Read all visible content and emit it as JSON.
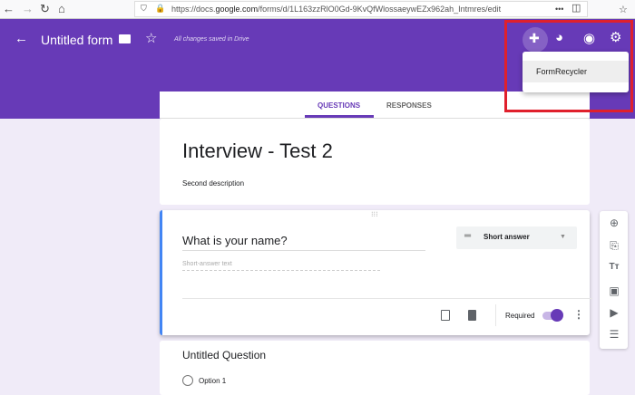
{
  "browser": {
    "url_prefix": "https://docs.",
    "url_domain": "google.com",
    "url_path": "/forms/d/1L163zzRlO0Gd-9KvQfWlossaeywEZx962ah_Intmres/edit",
    "more": "•••"
  },
  "header": {
    "title": "Untitled form",
    "saved_status": "All changes saved in Drive"
  },
  "tabs": [
    "QUESTIONS",
    "RESPONSES"
  ],
  "form": {
    "title": "Interview - Test 2",
    "description": "Second description"
  },
  "question": {
    "title": "What is your name?",
    "type": "Short answer",
    "placeholder": "Short-answer text",
    "required_label": "Required",
    "required": true
  },
  "next_question": {
    "title": "Untitled Question",
    "option": "Option 1"
  },
  "addon_menu": {
    "items": [
      "FormRecycler"
    ]
  },
  "colors": {
    "primary": "#673ab7",
    "highlight": "#e0202c"
  }
}
